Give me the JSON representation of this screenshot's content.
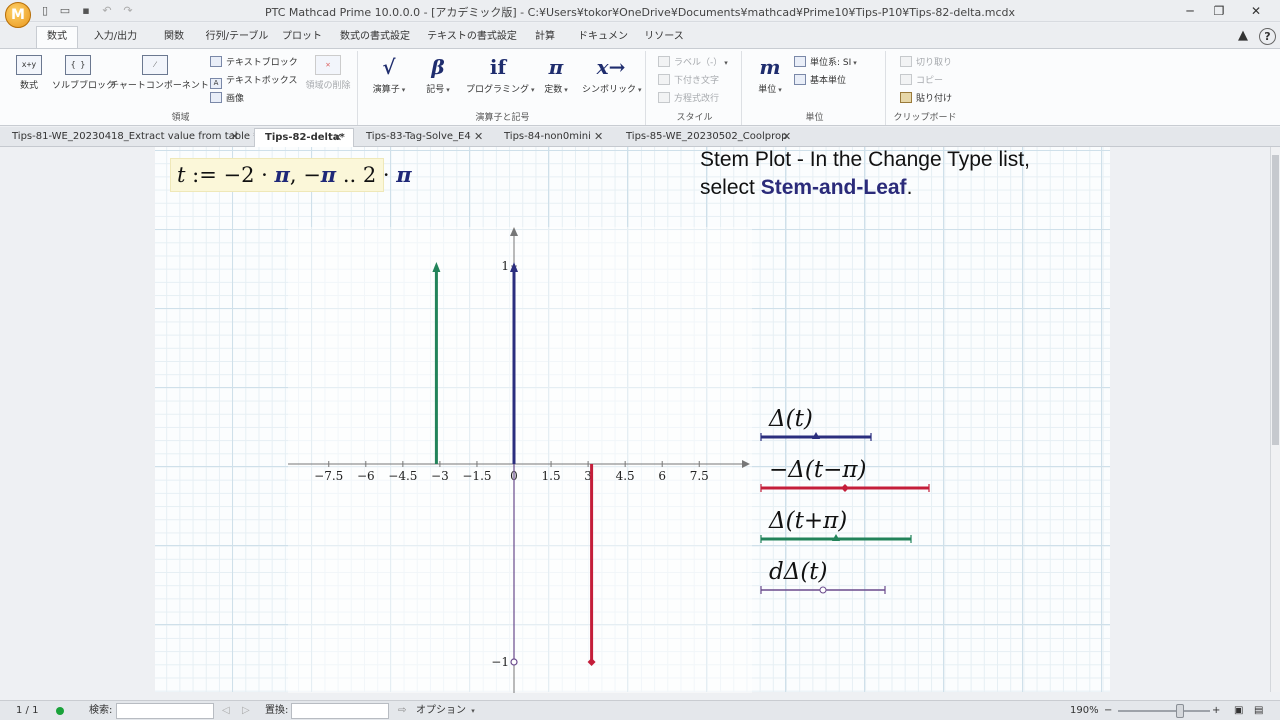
{
  "window": {
    "title": "PTC Mathcad Prime 10.0.0.0 - [アカデミック版] - C:¥Users¥tokor¥OneDrive¥Documents¥mathcad¥Prime10¥Tips-P10¥Tips-82-delta.mcdx",
    "logo_letter": "M",
    "minimize": "─",
    "restore": "❐",
    "close": "✕"
  },
  "ribbon_tabs": [
    "数式",
    "入力/出力",
    "関数",
    "行列/テーブル",
    "プロット",
    "数式の書式設定",
    "テキストの書式設定",
    "計算",
    "ドキュメント",
    "リソース"
  ],
  "help_label": "?",
  "ribbon": {
    "region": {
      "math": "数式",
      "math_icon": "x+y",
      "solve_block": "ソルブブロック",
      "solve_icon": "{ }",
      "chart": "チャートコンポーネント",
      "text_block": "テキストブロック",
      "text_box": "テキストボックス",
      "text_box_icon": "A",
      "image": "画像",
      "delete_region": "領域の削除",
      "group": "領域"
    },
    "operators": {
      "operators": "演算子",
      "operators_icon": "√",
      "symbols": "記号",
      "symbols_icon": "β",
      "programming": "プログラミング",
      "programming_icon": "if",
      "constants": "定数",
      "constants_icon": "π",
      "symbolic": "シンボリック",
      "symbolic_icon": "x→",
      "group": "演算子と記号"
    },
    "style": {
      "label": "ラベル（-）",
      "subscript": "下付き文字",
      "line_break": "方程式改行",
      "group": "スタイル"
    },
    "units": {
      "units": "単位",
      "units_icon": "m",
      "unit_system": "単位系: SI",
      "base_units": "基本単位",
      "group": "単位"
    },
    "clipboard": {
      "cut": "切り取り",
      "copy": "コピー",
      "paste": "貼り付け",
      "group": "クリップボード"
    }
  },
  "doc_tabs": [
    {
      "label": "Tips-81-WE_20230418_Extract value from table *",
      "active": false
    },
    {
      "label": "Tips-82-delta*",
      "active": true
    },
    {
      "label": "Tips-83-Tag-Solve_E4",
      "active": false
    },
    {
      "label": "Tips-84-non0mini",
      "active": false
    },
    {
      "label": "Tips-85-WE_20230502_Coolprop",
      "active": false
    }
  ],
  "tab_close": "✕",
  "document": {
    "definition": {
      "var": "t",
      "assign": " := −2 · ",
      "pi1": "π",
      "mid": ", −",
      "pi2": "π",
      "range": " .. 2 · ",
      "pi3": "π"
    },
    "note_line1": "Stem Plot - In the Change Type list,",
    "note_line2_prefix": "select ",
    "note_bold": "Stem-and-Leaf",
    "note_line2_suffix": "."
  },
  "chart_data": {
    "type": "stem",
    "xlim": [
      -12,
      12
    ],
    "ylim": [
      -1,
      1
    ],
    "x_ticks": [
      -7.5,
      -6,
      -4.5,
      -3,
      -1.5,
      0,
      1.5,
      3,
      4.5,
      6,
      7.5
    ],
    "x_tick_labels": [
      "−7.5",
      "−6",
      "−4.5",
      "−3",
      "−1.5",
      "0",
      "1.5",
      "3",
      "4.5",
      "6",
      "7.5"
    ],
    "y_ticks": [
      -1,
      1
    ],
    "y_tick_labels": [
      "−1",
      "1"
    ],
    "series": [
      {
        "name": "Δ(t)",
        "color": "#2b2e7e",
        "marker": "triangle",
        "x": [
          0
        ],
        "y": [
          1
        ]
      },
      {
        "name": "−Δ(t−π)",
        "color": "#c41e3a",
        "marker": "diamond",
        "x": [
          3.1416
        ],
        "y": [
          -1
        ]
      },
      {
        "name": "Δ(t+π)",
        "color": "#22835a",
        "marker": "triangle",
        "x": [
          -3.1416
        ],
        "y": [
          1
        ]
      },
      {
        "name": "dΔ(t)",
        "color": "#6a4a8c",
        "marker": "circle",
        "x": [
          0
        ],
        "y": [
          -1
        ]
      }
    ]
  },
  "status": {
    "page": "1 / 1",
    "search_label": "検索:",
    "replace_label": "置換:",
    "options": "オプション",
    "zoom": "190%",
    "zoom_minus": "−",
    "zoom_plus": "+"
  }
}
